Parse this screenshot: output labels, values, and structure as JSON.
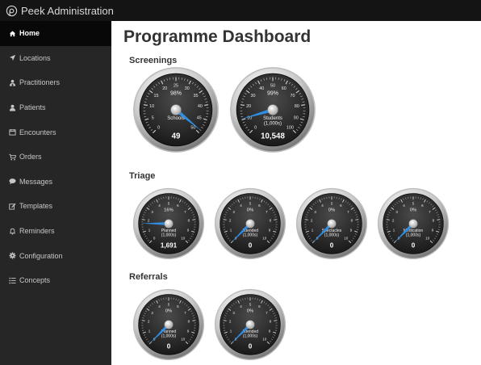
{
  "app": {
    "brand": "Peek Administration"
  },
  "sidebar": {
    "items": [
      {
        "label": "Home",
        "icon": "home-icon",
        "active": true
      },
      {
        "label": "Locations",
        "icon": "location-arrow-icon",
        "active": false
      },
      {
        "label": "Practitioners",
        "icon": "user-md-icon",
        "active": false
      },
      {
        "label": "Patients",
        "icon": "user-icon",
        "active": false
      },
      {
        "label": "Encounters",
        "icon": "calendar-icon",
        "active": false
      },
      {
        "label": "Orders",
        "icon": "cart-icon",
        "active": false
      },
      {
        "label": "Messages",
        "icon": "comment-icon",
        "active": false
      },
      {
        "label": "Templates",
        "icon": "edit-icon",
        "active": false
      },
      {
        "label": "Reminders",
        "icon": "bell-icon",
        "active": false
      },
      {
        "label": "Configuration",
        "icon": "gear-icon",
        "active": false
      },
      {
        "label": "Concepts",
        "icon": "list-icon",
        "active": false
      }
    ]
  },
  "main": {
    "title": "Programme Dashboard",
    "sections": [
      {
        "title": "Screenings"
      },
      {
        "title": "Triage"
      },
      {
        "title": "Referrals"
      }
    ]
  },
  "gauges": [
    {
      "label": [
        "Schools"
      ],
      "percent": "98%",
      "value": "49",
      "scale": [
        0,
        5,
        10,
        15,
        20,
        25,
        30,
        35,
        40,
        45,
        50
      ],
      "current": 49
    },
    {
      "label": [
        "Students",
        "(1,000s)"
      ],
      "percent": "99%",
      "value": "10,548",
      "scale": [
        0,
        10,
        20,
        30,
        40,
        50,
        60,
        70,
        80,
        90,
        100
      ],
      "current": 10.548
    },
    {
      "label": [
        "Planned",
        "(1,000s)"
      ],
      "percent": "16%",
      "value": "1,691",
      "scale": [
        0,
        1,
        2,
        3,
        4,
        5,
        6,
        7,
        8,
        9,
        10
      ],
      "current": 1.691
    },
    {
      "label": [
        "Attended",
        "(1,000s)"
      ],
      "percent": "0%",
      "value": "0",
      "scale": [
        0,
        1,
        2,
        3,
        4,
        5,
        6,
        7,
        8,
        9,
        10
      ],
      "current": 0
    },
    {
      "label": [
        "Spectacles",
        "(1,000s)"
      ],
      "percent": "0%",
      "value": "0",
      "scale": [
        0,
        1,
        2,
        3,
        4,
        5,
        6,
        7,
        8,
        9,
        10
      ],
      "current": 0
    },
    {
      "label": [
        "Medication",
        "(1,000s)"
      ],
      "percent": "0%",
      "value": "0",
      "scale": [
        0,
        1,
        2,
        3,
        4,
        5,
        6,
        7,
        8,
        9,
        10
      ],
      "current": 0
    },
    {
      "label": [
        "Planned",
        "(1,000s)"
      ],
      "percent": "0%",
      "value": "0",
      "scale": [
        0,
        1,
        2,
        3,
        4,
        5,
        6,
        7,
        8,
        9,
        10
      ],
      "current": 0
    },
    {
      "label": [
        "Attended",
        "(1,000s)"
      ],
      "percent": "0%",
      "value": "0",
      "scale": [
        0,
        1,
        2,
        3,
        4,
        5,
        6,
        7,
        8,
        9,
        10
      ],
      "current": 0
    }
  ],
  "colors": {
    "needle": "#2f8fe6",
    "dial": "#222222",
    "sidebar": "#262626",
    "topbar": "#141414"
  }
}
